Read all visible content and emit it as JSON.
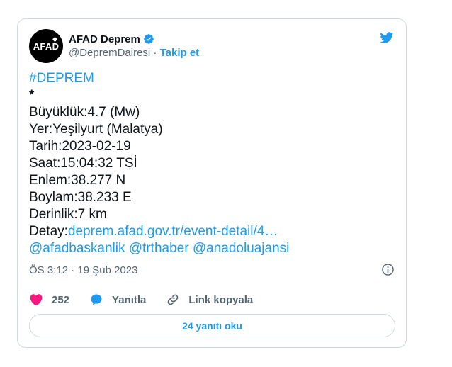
{
  "tweet": {
    "avatar_text": "AFAD",
    "display_name": "AFAD Deprem",
    "handle": "@DepremDairesi",
    "separator": " · ",
    "follow_label": "Takip et",
    "body": {
      "hashtag": "#DEPREM",
      "star": "*",
      "magnitude": "Büyüklük:4.7 (Mw)",
      "location": "Yer:Yeşilyurt (Malatya)",
      "date": "Tarih:2023-02-19",
      "time": "Saat:15:04:32 TSİ",
      "latitude": "Enlem:38.277 N",
      "longitude": "Boylam:38.233 E",
      "depth": "Derinlik:7 km",
      "detail_prefix": "Detay:",
      "detail_link": "deprem.afad.gov.tr/event-detail/4…",
      "mention_1": "@afadbaskanlik",
      "mention_2": "@trthaber",
      "mention_3": "@anadoluajansi"
    },
    "timestamp": "ÖS 3:12 · 19 Şub 2023",
    "actions": {
      "likes_count": "252",
      "reply_label": "Yanıtla",
      "copy_link_label": "Link kopyala"
    },
    "read_replies_label": "24 yanıtı oku"
  },
  "colors": {
    "accent": "#1d9bf0",
    "like": "#f91880",
    "text": "#0f1419",
    "muted": "#536471",
    "border": "#cfd9de"
  },
  "icons": [
    "verified-badge-icon",
    "twitter-bird-icon",
    "info-icon",
    "heart-icon",
    "reply-bubble-icon",
    "link-icon"
  ]
}
